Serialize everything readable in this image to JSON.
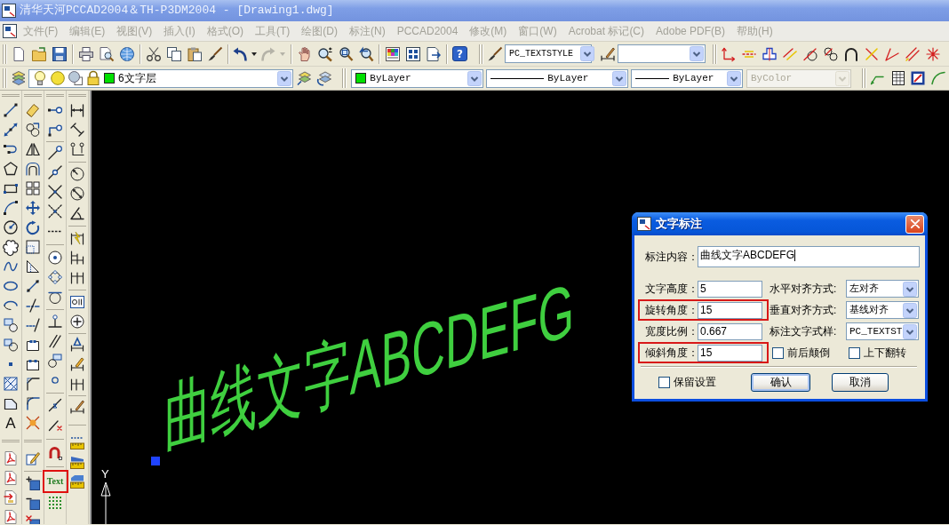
{
  "window": {
    "title": "清华天河PCCAD2004＆TH-P3DM2004 - [Drawing1.dwg]"
  },
  "menu_bar": {
    "items": [
      {
        "label": "文件(F)",
        "disabled": true
      },
      {
        "label": "编辑(E)",
        "disabled": true
      },
      {
        "label": "视图(V)",
        "disabled": true
      },
      {
        "label": "插入(I)",
        "disabled": true
      },
      {
        "label": "格式(O)",
        "disabled": true
      },
      {
        "label": "工具(T)",
        "disabled": true
      },
      {
        "label": "绘图(D)",
        "disabled": true
      },
      {
        "label": "标注(N)",
        "disabled": true
      },
      {
        "label": "PCCAD2004",
        "disabled": true
      },
      {
        "label": "修改(M)",
        "disabled": true
      },
      {
        "label": "窗口(W)",
        "disabled": true
      },
      {
        "label": "Acrobat 标记(C)",
        "disabled": true
      },
      {
        "label": "Adobe PDF(B)",
        "disabled": true
      },
      {
        "label": "帮助(H)",
        "disabled": true
      }
    ]
  },
  "standard_toolbar": {
    "redo": {
      "disabled": true
    },
    "help_glyph": "?"
  },
  "text_style_toolbar": {
    "text_style": "PC_TEXTSTYLE"
  },
  "layers_toolbar": {
    "layer": "6文字层"
  },
  "properties_toolbar": {
    "color_setting": "ByLayer",
    "linetype": "ByLayer",
    "lineweight": "ByLayer",
    "plot_style": {
      "value": "ByColor",
      "disabled": true
    }
  },
  "draw_toolbar": {
    "text_glyph": "A"
  },
  "text_tool": {
    "label": "Text",
    "highlighted": true
  },
  "drawing": {
    "text": "曲线文字ABCDEFG",
    "ucs_axis_label": "Y"
  },
  "dialog": {
    "title": "文字标注",
    "content": {
      "label": "标注内容：",
      "value": "曲线文字ABCDEFG"
    },
    "fields": [
      {
        "label": "文字高度：",
        "value": "5",
        "highlighted": false
      },
      {
        "label": "旋转角度：",
        "value": "15",
        "highlighted": true
      },
      {
        "label": "宽度比例：",
        "value": "0.667",
        "highlighted": false
      },
      {
        "label": "倾斜角度：",
        "value": "15",
        "highlighted": true
      }
    ],
    "dropdowns": [
      {
        "label": "水平对齐方式:",
        "value": "左对齐"
      },
      {
        "label": "垂直对齐方式:",
        "value": "基线对齐"
      },
      {
        "label": "标注文字式样:",
        "value": "PC_TEXTST"
      }
    ],
    "checkboxes": [
      {
        "label": "前后颠倒",
        "checked": false
      },
      {
        "label": "上下翻转",
        "checked": false
      }
    ],
    "keep_settings": {
      "label": "保留设置",
      "checked": false
    },
    "buttons": [
      {
        "label": "确认",
        "default": true
      },
      {
        "label": "取消",
        "default": false
      }
    ]
  }
}
